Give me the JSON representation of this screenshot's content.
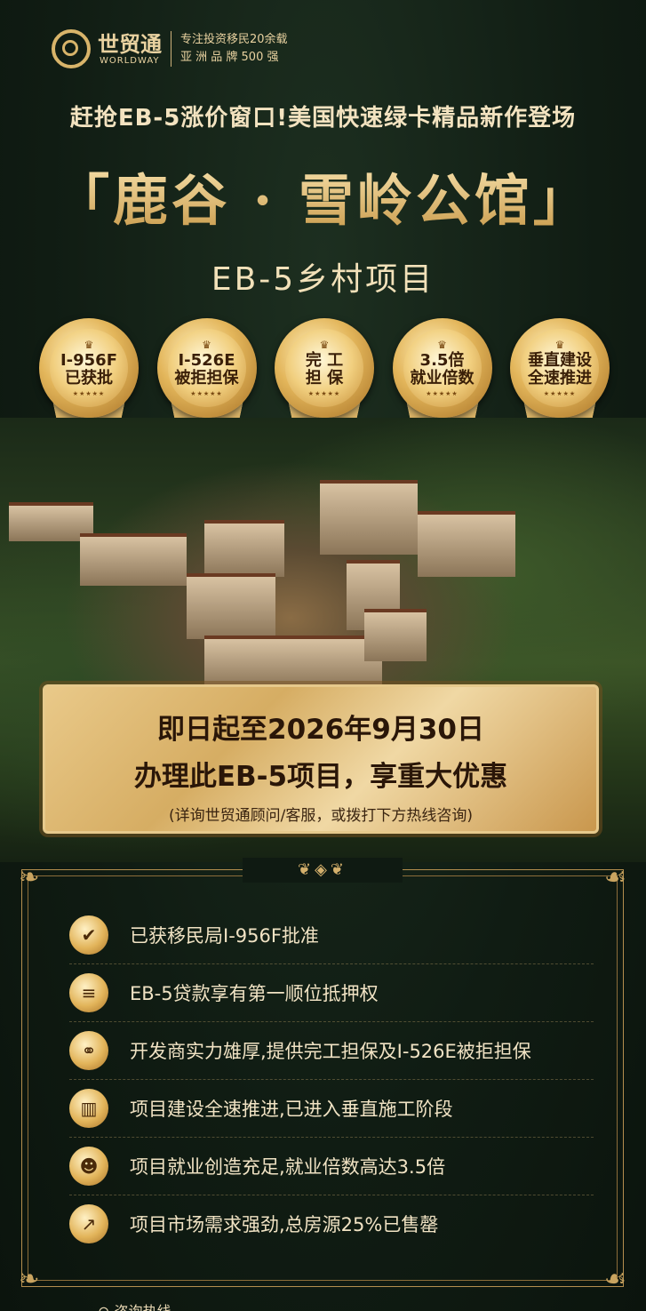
{
  "header": {
    "logo_cn": "世贸通",
    "logo_en": "WORLDWAY",
    "tagline_1": "专注投资移民20余载",
    "tagline_2": "亚 洲 品 牌 500 强"
  },
  "headline": "赶抢EB-5涨价窗口!美国快速绿卡精品新作登场",
  "title": "「鹿谷 · 雪岭公馆」",
  "subtitle": "EB-5乡村项目",
  "badges": [
    {
      "line1": "I-956F",
      "line2": "已获批"
    },
    {
      "line1": "I-526E",
      "line2": "被拒担保"
    },
    {
      "line1": "完 工",
      "line2": "担 保"
    },
    {
      "line1": "3.5倍",
      "line2": "就业倍数"
    },
    {
      "line1": "垂直建设",
      "line2": "全速推进"
    }
  ],
  "promo": {
    "line1": "即日起至2026年9月30日",
    "line2": "办理此EB-5项目，享重大优惠",
    "note": "(详询世贸通顾问/客服，或拨打下方热线咨询)"
  },
  "features": [
    {
      "icon": "shield-check-icon",
      "text": "已获移民局I-956F批准"
    },
    {
      "icon": "layers-shield-icon",
      "text": "EB-5贷款享有第一顺位抵押权"
    },
    {
      "icon": "handshake-icon",
      "text": "开发商实力雄厚,提供完工担保及I-526E被拒担保"
    },
    {
      "icon": "building-icon",
      "text": "项目建设全速推进,已进入垂直施工阶段"
    },
    {
      "icon": "people-icon",
      "text": "项目就业创造充足,就业倍数高达3.5倍"
    },
    {
      "icon": "chart-up-icon",
      "text": "项目市场需求强劲,总房源25%已售罄"
    }
  ],
  "footer": {
    "label": "咨询热线"
  },
  "colors": {
    "gold": "#d8b46a",
    "dark_green": "#0f1a12",
    "cream": "#f1e3c4"
  }
}
